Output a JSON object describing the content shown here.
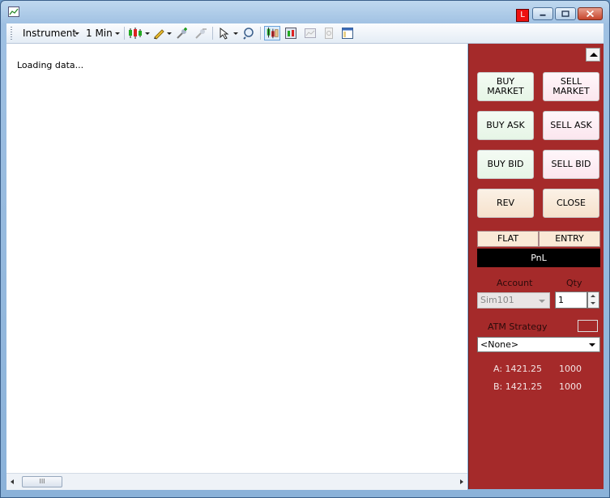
{
  "toolbar": {
    "instrument_label": "Instrument",
    "interval_label": "1 Min",
    "icons": [
      "bar-type-icon",
      "drawing-tool-icon",
      "zoom-in-icon",
      "zoom-out-icon",
      "cursor-icon",
      "magnifier-icon",
      "chart-trader-icon",
      "data-box-icon",
      "chart-image-icon",
      "save-icon",
      "properties-icon"
    ]
  },
  "window": {
    "badge": "L"
  },
  "chart": {
    "status_text": "Loading data...",
    "scroll_thumb_label": "III"
  },
  "panel": {
    "buttons": {
      "buy_market": "BUY\nMARKET",
      "sell_market": "SELL\nMARKET",
      "buy_ask": "BUY ASK",
      "sell_ask": "SELL ASK",
      "buy_bid": "BUY BID",
      "sell_bid": "SELL BID",
      "rev": "REV",
      "close": "CLOSE"
    },
    "position": "FLAT",
    "entry": "ENTRY",
    "pnl": "PnL",
    "account_label": "Account",
    "account_value": "Sim101",
    "qty_label": "Qty",
    "qty_value": "1",
    "atm_label": "ATM Strategy",
    "atm_value": "<None>",
    "ask": {
      "label": "A: 1421.25",
      "size": "1000"
    },
    "bid": {
      "label": "B: 1421.25",
      "size": "1000"
    }
  },
  "colors": {
    "panel_bg": "#a52a2a",
    "buy_btn": "#e6f5e6",
    "sell_btn": "#fbe6ee",
    "neutral_btn": "#f6e2cc"
  }
}
